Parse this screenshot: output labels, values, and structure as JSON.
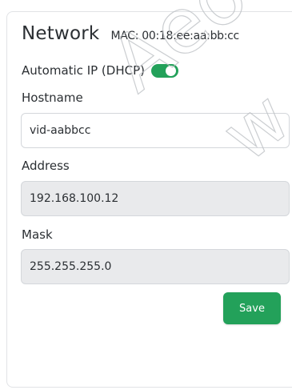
{
  "network": {
    "title": "Network",
    "mac": "MAC: 00:18:ee:aa:bb:cc",
    "dhcp_label": "Automatic IP (DHCP)",
    "dhcp_enabled": true,
    "hostname_label": "Hostname",
    "hostname_value": "vid-aabbcc",
    "address_label": "Address",
    "address_value": "192.168.100.12",
    "mask_label": "Mask",
    "mask_value": "255.255.255.0",
    "save_label": "Save"
  },
  "colors": {
    "accent": "#23a15a",
    "readonly_field": "#e9eaec"
  },
  "watermark": {
    "text_1": "Aeo",
    "text_2": "w"
  }
}
